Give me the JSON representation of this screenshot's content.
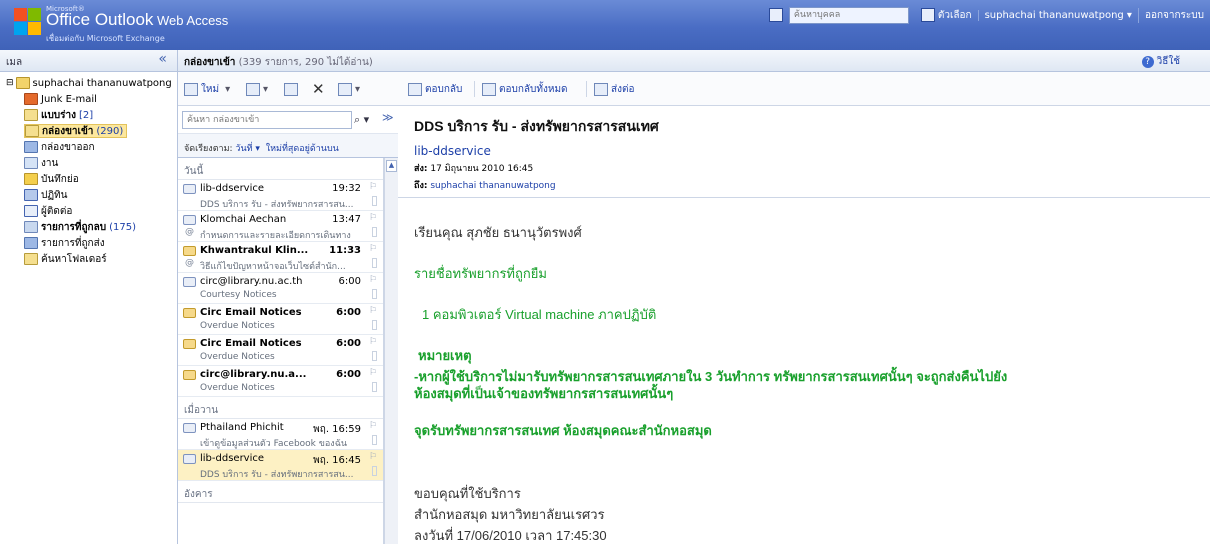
{
  "header": {
    "brand_small": "Microsoft®",
    "brand_office": "Office Outlook",
    "brand_product": " Web Access",
    "brand_sub": "เชื่อมต่อกับ Microsoft Exchange",
    "people_search_placeholder": "ค้นหาบุคคล",
    "options_label": "ตัวเลือก",
    "user_name": "suphachai thananuwatpong ▾",
    "logoff_label": "ออกจากระบบ"
  },
  "nav": {
    "title": "เมล",
    "collapse": "«",
    "root": "suphachai thananuwatpong",
    "folders": [
      {
        "label": "Junk E-mail",
        "count": ""
      },
      {
        "label": "แบบร่าง",
        "count": "[2]"
      },
      {
        "label": "กล่องขาเข้า",
        "count": "(290)"
      },
      {
        "label": "กล่องขาออก",
        "count": ""
      },
      {
        "label": "งาน",
        "count": ""
      },
      {
        "label": "บันทึกย่อ",
        "count": ""
      },
      {
        "label": "ปฏิทิน",
        "count": ""
      },
      {
        "label": "ผู้ติดต่อ",
        "count": ""
      },
      {
        "label": "รายการที่ถูกลบ",
        "count": "(175)"
      },
      {
        "label": "รายการที่ถูกส่ง",
        "count": ""
      },
      {
        "label": "ค้นหาโฟลเดอร์",
        "count": ""
      }
    ]
  },
  "inbox": {
    "title": "กล่องขาเข้า",
    "meta": " (339 รายการ, 290 ไม่ได้อ่าน)",
    "help": "วิธีใช้",
    "new_label": "ใหม่",
    "search_placeholder": "ค้นหา กล่องขาเข้า",
    "arrange_label": "จัดเรียงตาม: ",
    "arrange_by": "วันที่ ▾",
    "arrange_order": "ใหม่ที่สุดอยู่ด้านบน",
    "groups": [
      {
        "label": "วันนี้",
        "messages": [
          {
            "from": "lib-ddservice",
            "time": "19:32",
            "subject": "DDS บริการ รับ - ส่งทรัพยากรสารสน...",
            "unread": false,
            "att": false
          },
          {
            "from": "Klomchai Aechan",
            "time": "13:47",
            "subject": "กำหนดการและรายละเอียดการเดินทาง",
            "unread": false,
            "att": true
          },
          {
            "from": "Khwantrakul Klin...",
            "time": "11:33",
            "subject": "วิธีแก้ไขปัญหาหน้าจอเว็บไซต์สำนัก...",
            "unread": true,
            "att": true
          },
          {
            "from": "circ@library.nu.ac.th",
            "time": "6:00",
            "subject": "Courtesy Notices",
            "unread": false,
            "att": false
          },
          {
            "from": "Circ Email Notices",
            "time": "6:00",
            "subject": "Overdue Notices",
            "unread": true,
            "att": false
          },
          {
            "from": "Circ Email Notices",
            "time": "6:00",
            "subject": "Overdue Notices",
            "unread": true,
            "att": false
          },
          {
            "from": "circ@library.nu.a...",
            "time": "6:00",
            "subject": "Overdue Notices",
            "unread": true,
            "att": false
          }
        ]
      },
      {
        "label": "เมื่อวาน",
        "messages": [
          {
            "from": "Pthailand Phichit",
            "time": "พฤ. 16:59",
            "subject": "เข้าดูข้อมูลส่วนตัว Facebook ของฉัน",
            "unread": false,
            "att": false
          },
          {
            "from": "lib-ddservice",
            "time": "พฤ. 16:45",
            "subject": "DDS บริการ รับ - ส่งทรัพยากรสารสน...",
            "unread": false,
            "att": false,
            "selected": true
          }
        ]
      },
      {
        "label": "อังคาร",
        "messages": []
      }
    ]
  },
  "reading": {
    "reply": "ตอบกลับ",
    "reply_all": "ตอบกลับทั้งหมด",
    "forward": "ส่งต่อ",
    "subject": "DDS บริการ รับ - ส่งทรัพยากรสารสนเทศ",
    "from": "lib-ddservice",
    "sent_key": "ส่ง:",
    "sent_value": " 17 มิถุนายน 2010 16:45",
    "to_key": "ถึง:",
    "to_value": " suphachai thananuwatpong",
    "body": {
      "greeting": "เรียนคุณ สุภชัย ธนานุวัตรพงศ์",
      "list_title": "รายชื่อทรัพยากรที่ถูกยืม",
      "item": "1     คอมพิวเตอร์ Virtual machine ภาคปฏิบัติ",
      "note_title": "หมายเหตุ",
      "note_text": "-หากผู้ใช้บริการไม่มารับทรัพยากรสารสนเทศภายใน 3 วันทำการ ทรัพยากรสารสนเทศนั้นๆ จะถูกส่งคืนไปยังห้องสมุดที่เป็นเจ้าของทรัพยากรสารสนเทศนั้นๆ",
      "pickup": "จุดรับทรัพยากรสารสนเทศ ห้องสมุดคณะสำนักหอสมุด",
      "thanks": "ขอบคุณที่ใช้บริการ",
      "org": "สำนักหอสมุด มหาวิทยาลัยนเรศวร",
      "date_line": "ลงวันที่   17/06/2010  เวลา 17:45:30"
    }
  }
}
